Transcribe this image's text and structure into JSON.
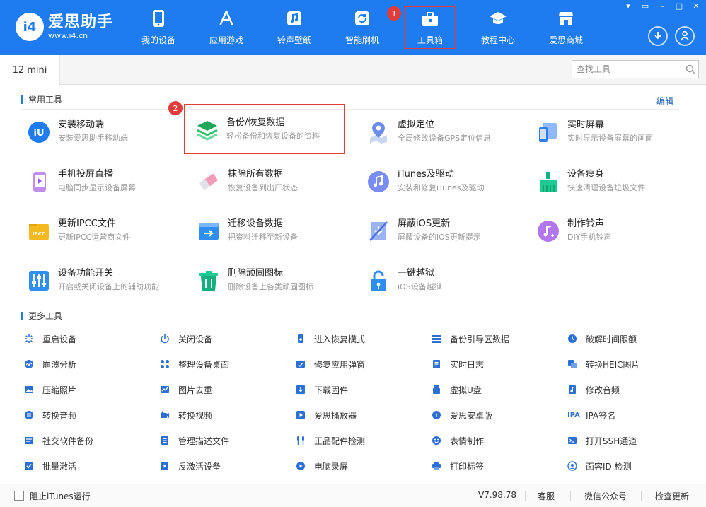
{
  "app": {
    "logo_badge": "i4",
    "logo_name": "爱思助手",
    "logo_url": "www.i4.cn"
  },
  "nav": [
    {
      "label": "我的设备",
      "icon": "phone-icon"
    },
    {
      "label": "应用游戏",
      "icon": "app-store-icon"
    },
    {
      "label": "铃声壁纸",
      "icon": "music-note-icon"
    },
    {
      "label": "智能刷机",
      "icon": "refresh-icon"
    },
    {
      "label": "工具箱",
      "icon": "toolbox-icon",
      "active": true
    },
    {
      "label": "教程中心",
      "icon": "graduation-cap-icon"
    },
    {
      "label": "爱思商城",
      "icon": "shop-icon"
    }
  ],
  "annotations": {
    "badge1": "1",
    "badge2": "2"
  },
  "tabbar": {
    "device_tab": "12 mini",
    "search_placeholder": "查找工具"
  },
  "common": {
    "title": "常用工具",
    "edit": "编辑",
    "tools": [
      {
        "name": "安装移动端",
        "desc": "安装爱思助手移动端"
      },
      {
        "name": "备份/恢复数据",
        "desc": "轻松备份和恢复设备的资料"
      },
      {
        "name": "虚拟定位",
        "desc": "全局修改设备GPS定位信息"
      },
      {
        "name": "实时屏幕",
        "desc": "实时显示设备屏幕的画面"
      },
      {
        "name": "手机投屏直播",
        "desc": "电脑同步显示设备屏幕"
      },
      {
        "name": "抹除所有数据",
        "desc": "恢复设备到出厂状态"
      },
      {
        "name": "iTunes及驱动",
        "desc": "安装和修复iTunes及驱动"
      },
      {
        "name": "设备瘦身",
        "desc": "快速清理设备垃圾文件"
      },
      {
        "name": "更新IPCC文件",
        "desc": "更新IPCC运营商文件"
      },
      {
        "name": "迁移设备数据",
        "desc": "把资料迁移至新设备"
      },
      {
        "name": "屏蔽iOS更新",
        "desc": "屏蔽设备的iOS更新提示"
      },
      {
        "name": "制作铃声",
        "desc": "DIY手机铃声"
      },
      {
        "name": "设备功能开关",
        "desc": "开启或关闭设备上的辅助功能"
      },
      {
        "name": "删除顽固图标",
        "desc": "删除设备上各类顽固图标"
      },
      {
        "name": "一键越狱",
        "desc": "iOS设备越狱"
      }
    ]
  },
  "more": {
    "title": "更多工具",
    "items": [
      [
        "重启设备",
        "关闭设备",
        "进入恢复模式",
        "备份引导区数据",
        "破解时间限额"
      ],
      [
        "崩溃分析",
        "整理设备桌面",
        "修复应用弹窗",
        "实时日志",
        "转换HEIC图片"
      ],
      [
        "压缩照片",
        "图片去重",
        "下载固件",
        "虚拟U盘",
        "修改音频"
      ],
      [
        "转换音频",
        "转换视频",
        "爱思播放器",
        "爱思安卓版",
        "IPA签名"
      ],
      [
        "社交软件备份",
        "管理描述文件",
        "正品配件检测",
        "表情制作",
        "打开SSH通道"
      ],
      [
        "批量激活",
        "反激活设备",
        "电脑录屏",
        "打印标签",
        "面容ID 检测"
      ]
    ],
    "ipa_icon_text": "IPA"
  },
  "statusbar": {
    "block_itunes": "阻止iTunes运行",
    "version": "V7.98.78",
    "service": "客服",
    "wechat": "微信公众号",
    "check_update": "检查更新"
  },
  "colors": {
    "brand": "#1e7cf0",
    "highlight": "#e23b3b"
  }
}
